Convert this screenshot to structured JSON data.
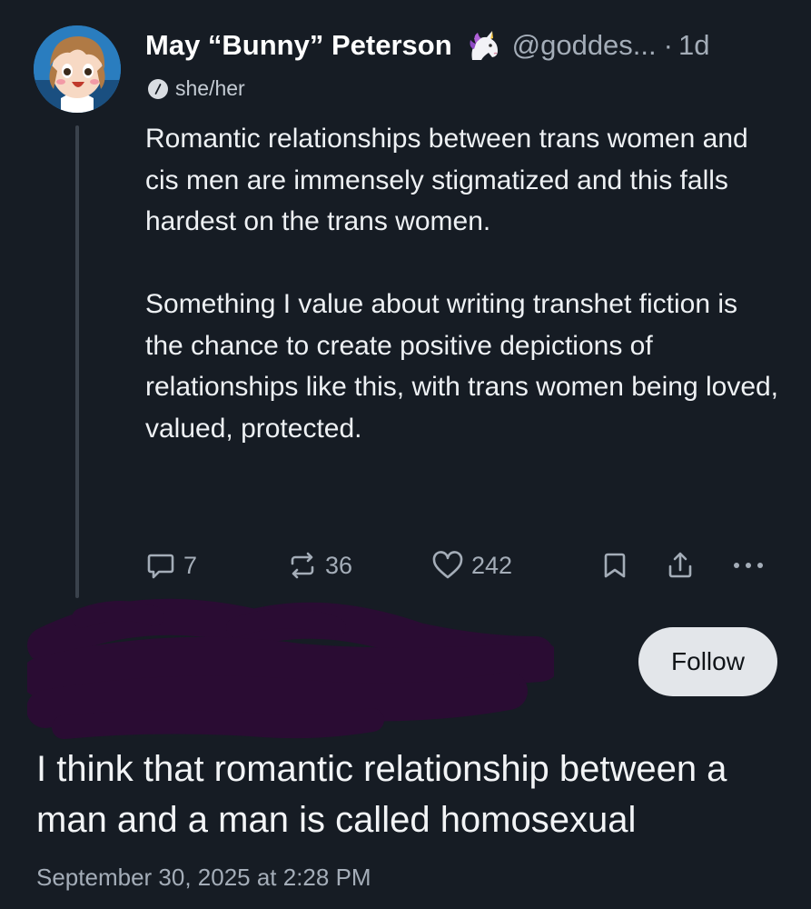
{
  "post": {
    "author": {
      "display_name": "May “Bunny” Peterson",
      "emoji_icon": "unicorn-icon",
      "handle": "@goddes...",
      "separator": "·",
      "age": "1d",
      "pronouns": "she/her"
    },
    "paragraphs": [
      "Romantic relationships between trans women and cis men are immensely stigmatized and this falls hardest on the trans women.",
      "Something I value about writing transhet fiction is the chance to create positive depictions of relationships like this, with trans women being loved, valued, protected."
    ],
    "actions": {
      "reply_count": "7",
      "repost_count": "36",
      "like_count": "242"
    }
  },
  "reply": {
    "follow_label": "Follow",
    "text": "I think that romantic relationship between a man and a man is called homosexual",
    "timestamp": "September 30, 2025 at 2:28 PM"
  },
  "colors": {
    "background": "#161c24",
    "text": "#e7e9ea",
    "muted": "#a4adb8",
    "redaction": "#2a0c33",
    "follow_bg": "#e3e6ea"
  }
}
